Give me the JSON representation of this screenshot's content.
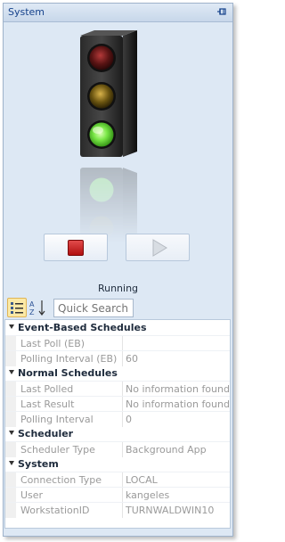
{
  "window": {
    "title": "System"
  },
  "status": {
    "text": "Running"
  },
  "search": {
    "placeholder": "Quick Search"
  },
  "colors": {
    "accent": "#15428b",
    "panel_bg": "#dde8f4",
    "light_red": "#5a1414",
    "light_amber": "#6a5410",
    "light_green": "#7be848",
    "stop_red": "#c51e1e"
  },
  "icons": {
    "pin": "pin-icon",
    "traffic_light": "traffic-light-icon",
    "stop": "stop-icon",
    "play": "play-icon",
    "categorized": "categorized-view-icon",
    "alphabetical": "sort-alphabetical-icon"
  },
  "properties": [
    {
      "category": "Event-Based Schedules",
      "items": [
        {
          "name": "Last Poll (EB)",
          "value": ""
        },
        {
          "name": "Polling Interval (EB)",
          "value": "60"
        }
      ]
    },
    {
      "category": "Normal Schedules",
      "items": [
        {
          "name": "Last Polled",
          "value": "No information found."
        },
        {
          "name": "Last Result",
          "value": "No information found."
        },
        {
          "name": "Polling Interval",
          "value": "0"
        }
      ]
    },
    {
      "category": "Scheduler",
      "items": [
        {
          "name": "Scheduler Type",
          "value": "Background App"
        }
      ]
    },
    {
      "category": "System",
      "items": [
        {
          "name": "Connection Type",
          "value": "LOCAL"
        },
        {
          "name": "User",
          "value": "kangeles"
        },
        {
          "name": "WorkstationID",
          "value": "TURNWALDWIN10"
        }
      ]
    }
  ]
}
